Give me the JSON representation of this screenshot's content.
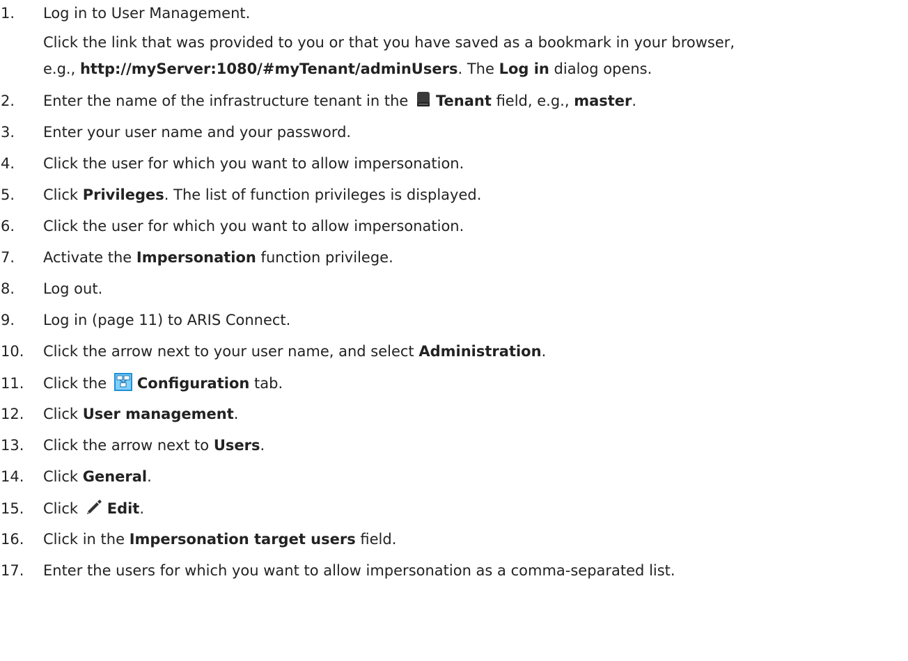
{
  "steps": [
    {
      "num": "1.",
      "text": "Log in to User Management."
    },
    {
      "num": "2.",
      "before": "Enter the name of the infrastructure tenant in the ",
      "bold": "Tenant",
      "after": " field, e.g., ",
      "bold2": "master",
      "after2": ".",
      "icon": "server-icon"
    },
    {
      "num": "3.",
      "text": "Enter your user name and your password."
    },
    {
      "num": "4.",
      "text": "Click the user for which you want to allow impersonation."
    },
    {
      "num": "5.",
      "before": "Click ",
      "bold": "Privileges",
      "after": ". The list of function privileges is displayed."
    },
    {
      "num": "6.",
      "text": "Click the user for which you want to allow impersonation."
    },
    {
      "num": "7.",
      "before": "Activate the ",
      "bold": "Impersonation",
      "after": " function privilege."
    },
    {
      "num": "8.",
      "text": "Log out."
    },
    {
      "num": "9.",
      "text": "Log in (page 11) to ARIS Connect."
    },
    {
      "num": "10.",
      "before": "Click the arrow next to your user name, and select ",
      "bold": "Administration",
      "after": "."
    },
    {
      "num": "11.",
      "before": "Click the ",
      "bold": "Configuration",
      "after": " tab.",
      "icon": "configuration-icon"
    },
    {
      "num": "12.",
      "before": "Click ",
      "bold": "User management",
      "after": "."
    },
    {
      "num": "13.",
      "before": "Click the arrow next to ",
      "bold": "Users",
      "after": "."
    },
    {
      "num": "14.",
      "before": "Click ",
      "bold": "General",
      "after": "."
    },
    {
      "num": "15.",
      "before": "Click ",
      "bold": "Edit",
      "after": ".",
      "icon": "pencil-icon"
    },
    {
      "num": "16.",
      "before": "Click in the ",
      "bold": "Impersonation target users",
      "after": " field."
    },
    {
      "num": "17.",
      "text": "Enter the users for which you want to allow impersonation as a comma-separated list."
    }
  ],
  "step1_detail": {
    "line1": "Click the link that was provided to you or that you have saved as a bookmark in your browser,",
    "line2_prefix": "e.g., ",
    "url": "http://myServer:1080/#myTenant/adminUsers",
    "line2_mid": ". The ",
    "dialog": "Log in",
    "line2_suffix": " dialog opens."
  }
}
